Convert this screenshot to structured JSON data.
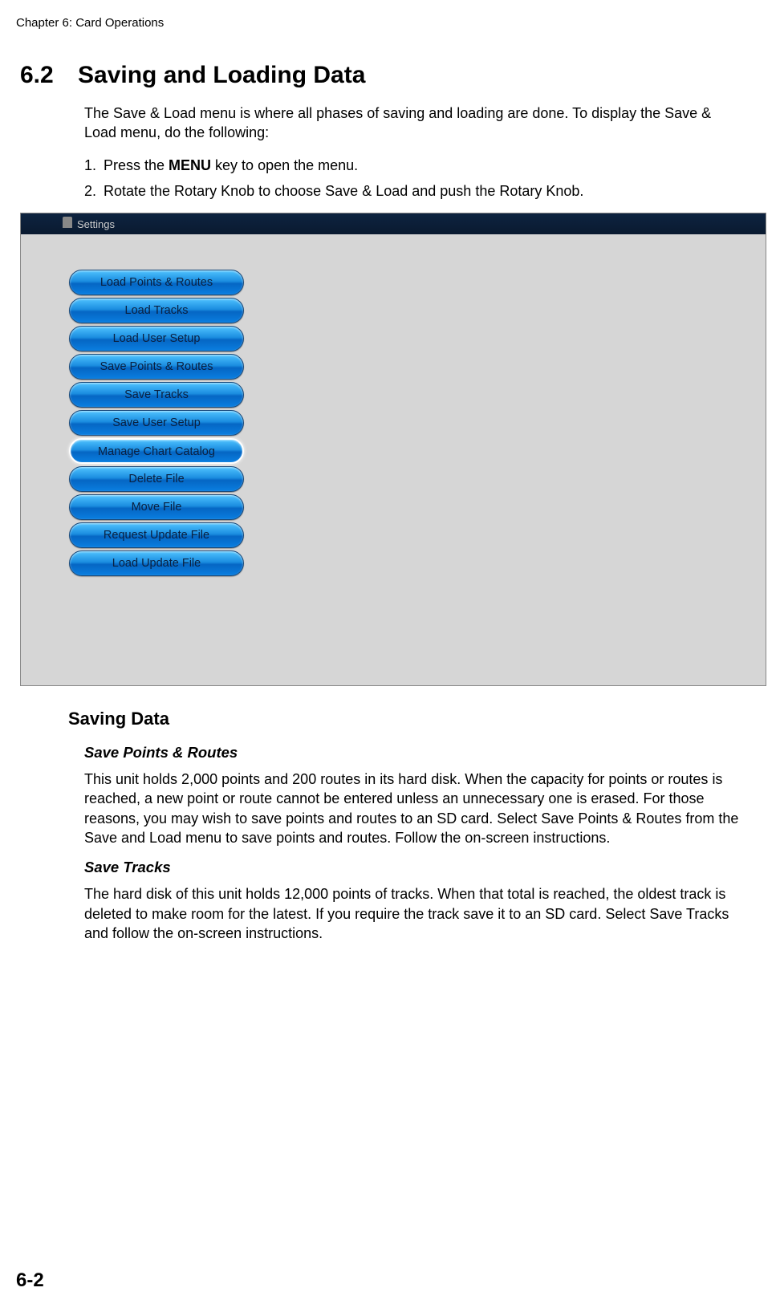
{
  "chapter_header": "Chapter 6: Card Operations",
  "section": {
    "number": "6.2",
    "title": "Saving and Loading Data"
  },
  "intro_text": "The Save & Load menu is where all phases of saving and loading are done. To display the Save & Load menu, do the following:",
  "steps": [
    {
      "num": "1.",
      "pre": "Press the ",
      "bold": "MENU",
      "post": " key to open the menu."
    },
    {
      "num": "2.",
      "pre": "Rotate the Rotary Knob to choose Save & Load and push the Rotary Knob.",
      "bold": "",
      "post": ""
    }
  ],
  "ui": {
    "tab_label": "Settings",
    "menu_items": [
      "Load Points & Routes",
      "Load Tracks",
      "Load User Setup",
      "Save Points & Routes",
      "Save Tracks",
      "Save User Setup",
      "Manage Chart Catalog",
      "Delete File",
      "Move File",
      "Request Update File",
      "Load Update File"
    ],
    "selected_index": 6
  },
  "saving_data": {
    "heading": "Saving Data",
    "sub1": {
      "title": "Save Points & Routes",
      "text": "This unit holds 2,000 points and 200 routes in its hard disk. When the capacity for points or routes is reached, a new point or route cannot be entered unless an unnecessary one is erased. For those reasons, you may wish to save points and routes to an SD card. Select Save Points & Routes from the Save and Load menu to save points and routes. Follow the on-screen instructions."
    },
    "sub2": {
      "title": "Save Tracks",
      "text": "The hard disk of this unit holds 12,000 points of tracks. When that total is reached, the oldest track is deleted to make room for the latest. If you require the track save it to an SD card. Select Save Tracks and follow the on-screen instructions."
    }
  },
  "page_number": "6-2"
}
